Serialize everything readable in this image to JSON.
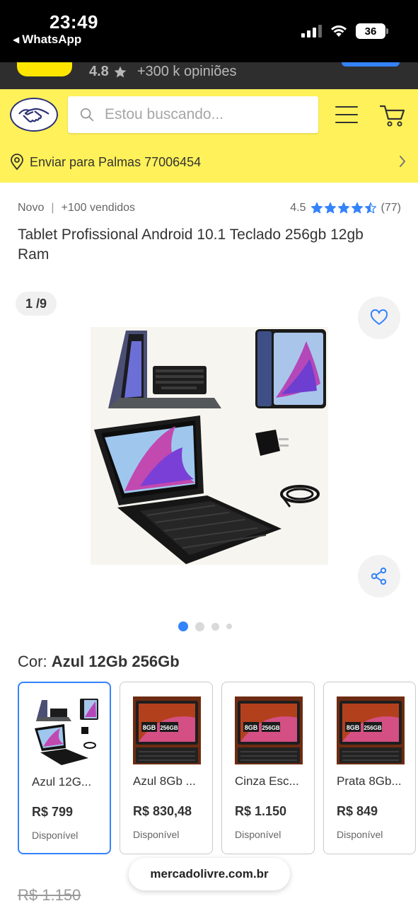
{
  "status_bar": {
    "time": "23:49",
    "back_app": "WhatsApp",
    "battery": "36"
  },
  "app_promo": {
    "rating": "4.8",
    "opinions": "+300 k opiniões"
  },
  "header": {
    "search_placeholder": "Estou buscando...",
    "address": "Enviar para Palmas 77006454"
  },
  "product": {
    "condition": "Novo",
    "separator": "|",
    "sold": "+100 vendidos",
    "rating": "4.5",
    "reviews": "(77)",
    "stars_value": 4.5,
    "title": "Tablet Profissional Android 10.1 Teclado 256gb 12gb Ram",
    "image_counter": "1 /9",
    "image_index": 1,
    "image_total": 9
  },
  "colors": {
    "label_prefix": "Cor:",
    "selected": "Azul 12Gb 256Gb",
    "variants": [
      {
        "name": "Azul 12G...",
        "price": "R$ 799",
        "status": "Disponível"
      },
      {
        "name": "Azul 8Gb ...",
        "price": "R$ 830,48",
        "status": "Disponível"
      },
      {
        "name": "Cinza Esc...",
        "price": "R$ 1.150",
        "status": "Disponível"
      },
      {
        "name": "Prata 8Gb...",
        "price": "R$ 849",
        "status": "Disponível"
      }
    ]
  },
  "price": {
    "old": "R$ 1.150"
  },
  "browser": {
    "url": "mercadolivre.com.br"
  },
  "theme": {
    "brand_yellow": "#fff159",
    "accent_blue": "#3483fa",
    "logo_navy": "#2d3277"
  },
  "icons": [
    "search-icon",
    "menu-icon",
    "cart-icon",
    "location-pin-icon",
    "chevron-right-icon",
    "heart-icon",
    "share-icon",
    "star-icon",
    "handshake-logo-icon"
  ]
}
